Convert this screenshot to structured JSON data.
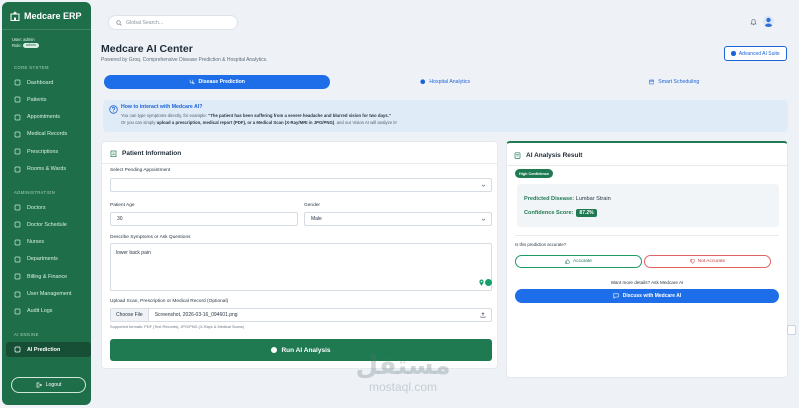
{
  "brand": {
    "name": "Medcare ERP"
  },
  "user": {
    "user_line": "User: admin",
    "role_label": "Role:",
    "role": "admin"
  },
  "sidebar": {
    "sections": [
      "CORE SYSTEM",
      "ADMINISTRATION",
      "AI ENGINE"
    ],
    "core": [
      {
        "label": "Dashboard",
        "icon": "dashboard-icon"
      },
      {
        "label": "Patients",
        "icon": "patients-icon"
      },
      {
        "label": "Appointments",
        "icon": "calendar-icon"
      },
      {
        "label": "Medical Records",
        "icon": "records-icon"
      },
      {
        "label": "Prescriptions",
        "icon": "pill-icon"
      },
      {
        "label": "Rooms & Wards",
        "icon": "bed-icon"
      }
    ],
    "admin": [
      {
        "label": "Doctors",
        "icon": "doctor-icon"
      },
      {
        "label": "Doctor Schedule",
        "icon": "schedule-icon"
      },
      {
        "label": "Nurses",
        "icon": "nurse-icon"
      },
      {
        "label": "Departments",
        "icon": "department-icon"
      },
      {
        "label": "Billing & Finance",
        "icon": "billing-icon"
      },
      {
        "label": "User Management",
        "icon": "user-icon"
      },
      {
        "label": "Audit Logs",
        "icon": "list-icon"
      }
    ],
    "ai": [
      {
        "label": "AI Prediction",
        "icon": "ai-icon",
        "active": true
      }
    ],
    "logout": "Logout"
  },
  "topbar": {
    "search_placeholder": "Global Search..."
  },
  "header": {
    "title": "Medcare AI Center",
    "subtitle": "Powered by Groq. Comprehensive Disease Prediction & Hospital Analytics.",
    "suite_button": "Advanced AI Suite"
  },
  "tabs": [
    {
      "label": "Disease Prediction",
      "active": true
    },
    {
      "label": "Hospital Analytics",
      "active": false
    },
    {
      "label": "Smart Scheduling",
      "active": false
    }
  ],
  "info": {
    "title": "How to interact with Medcare AI?",
    "line1_pre": "You can type symptoms directly, for example: ",
    "line1_bold": "\"The patient has been suffering from a severe headache and blurred vision for two days.\"",
    "line2_pre": "Or you can simply ",
    "line2_bold": "upload a prescription, medical report (PDF), or a Medical Scan (X-Ray/MRI in JPG/PNG)",
    "line2_post": ", and our Vision AI will analyze it!"
  },
  "patient": {
    "title": "Patient Information",
    "pending_label": "Select Pending Appointment",
    "pending_value": "",
    "age_label": "Patient Age",
    "age_value": "30",
    "gender_label": "Gender",
    "gender_value": "Male",
    "symptoms_label": "Describe Symptoms or Ask Questions",
    "symptoms_value": "lower back pain",
    "upload_label": "Upload Scan, Prescription or Medical Record (Optional)",
    "choose_file": "Choose File",
    "file_name": "Screenshot, 2026-03-16_094601.png",
    "supported": "Supported formats: PDF (Text Records), JPG/PNG (X-Rays & Medical Scans)",
    "run_button": "Run AI Analysis"
  },
  "result": {
    "title": "AI Analysis Result",
    "badge": "High Confidence",
    "pred_label": "Predicted Disease:",
    "pred_value": "Lumbar Strain",
    "conf_label": "Confidence Score:",
    "conf_value": "87.2%",
    "accuracy_q": "Is this prediction accurate?",
    "accurate": "Accurate",
    "not_accurate": "Not Accurate",
    "more_details": "Want more details? Ask Medcare AI",
    "discuss": "Discuss with Medcare AI"
  },
  "watermark": {
    "arabic": "مستقل",
    "latin": "mostaql.com"
  },
  "colors": {
    "sidebar": "#1f6e4a",
    "primary": "#1d6ee8",
    "success": "#1f7a52",
    "danger": "#e06363"
  }
}
